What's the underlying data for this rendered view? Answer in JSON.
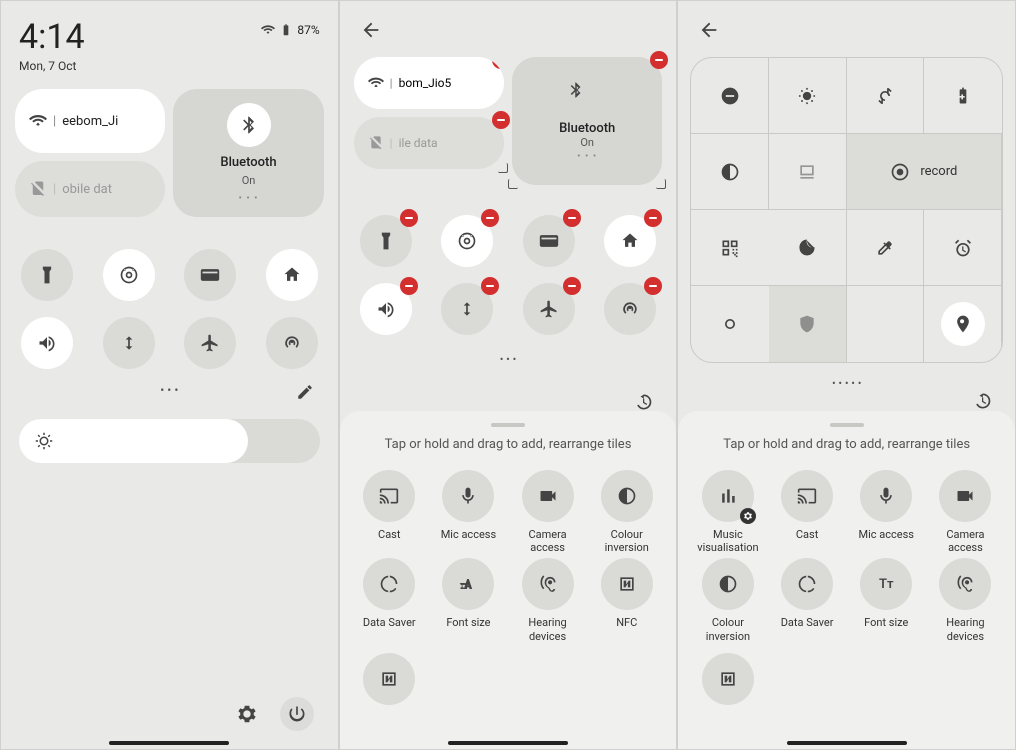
{
  "panel1": {
    "time": "4:14",
    "date": "Mon, 7 Oct",
    "battery": "87%",
    "wifi_label": "eebom_Ji",
    "mobile_label": "obile dat",
    "bt_title": "Bluetooth",
    "bt_sub": "On",
    "bt_dots": "• • •",
    "page_dots": "• • •"
  },
  "panel2": {
    "wifi_label": "bom_Jio5",
    "mobile_label": "ile data",
    "bt_title": "Bluetooth",
    "bt_sub": "On",
    "bt_dots": "• • •",
    "page_dots": "• • •",
    "drawer_hint": "Tap or hold and drag to add, rearrange tiles",
    "tiles": [
      {
        "label": "Cast"
      },
      {
        "label": "Mic access"
      },
      {
        "label": "Camera access"
      },
      {
        "label": "Colour inversion"
      },
      {
        "label": "Data Saver"
      },
      {
        "label": "Font size"
      },
      {
        "label": "Hearing devices"
      },
      {
        "label": "NFC"
      }
    ]
  },
  "panel3": {
    "screen_record_label": "record",
    "page_dots": "• • • • •",
    "drawer_hint": "Tap or hold and drag to add, rearrange tiles",
    "tiles": [
      {
        "label": "Music visualisation"
      },
      {
        "label": "Cast"
      },
      {
        "label": "Mic access"
      },
      {
        "label": "Camera access"
      },
      {
        "label": "Colour inversion"
      },
      {
        "label": "Data Saver"
      },
      {
        "label": "Font size"
      },
      {
        "label": "Hearing devices"
      }
    ]
  }
}
